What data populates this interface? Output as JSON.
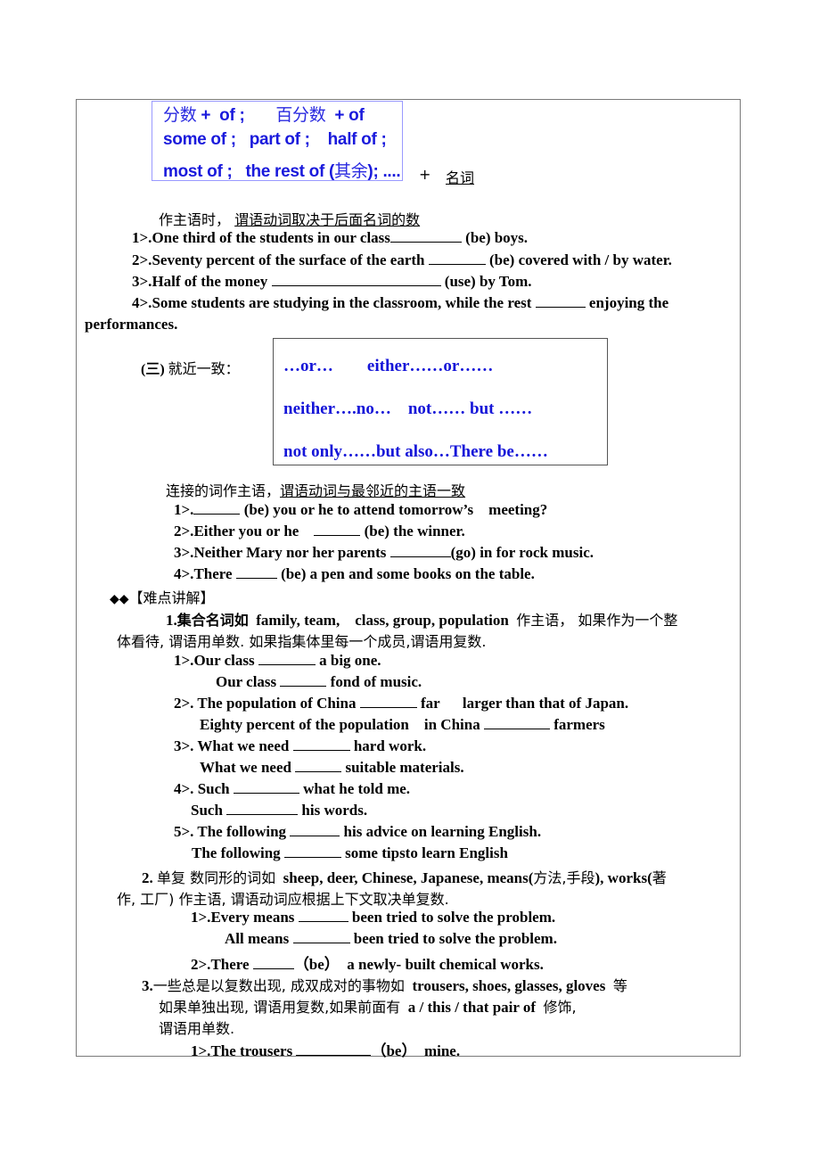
{
  "section_fraction": {
    "box_lines": [
      {
        "parts": [
          {
            "cn": "分数"
          },
          {
            "en": " +  of ;       "
          },
          {
            "cn": "百分数"
          },
          {
            "en": "  + of"
          }
        ]
      },
      {
        "parts": [
          {
            "en": "some of ;   part of ;    half of ;"
          }
        ]
      },
      {
        "parts": [
          {
            "en": "most of ;   the rest of ("
          },
          {
            "cn": "其余"
          },
          {
            "en": "); ...."
          }
        ]
      }
    ],
    "plus": "+",
    "noun_label": "名词",
    "rule_prefix": "作主语时，",
    "rule_underlined": "谓语动词取决于后面名词的数",
    "exercises": [
      {
        "num": "1>.",
        "before": "One third of the students in our class",
        "after": " (be) boys."
      },
      {
        "num": "2>.",
        "before": "Seventy percent of the surface of the earth ",
        "after": " (be) covered with / by water."
      },
      {
        "num": "3>.",
        "before": "Half of the money ",
        "after": " (use) by Tom."
      },
      {
        "num": "4>.",
        "before": "Some students are studying in the classroom, while the rest ",
        "after": " enjoying the"
      },
      {
        "continuation": "performances."
      }
    ]
  },
  "section_proximity": {
    "heading_num": "(三)",
    "heading_cn": "就近一致：",
    "box_lines": [
      "…or…        either……or……",
      "neither….no…    not…… but ……",
      "not only……but also…There be……"
    ],
    "rule_prefix": "连接的词作主语，",
    "rule_underlined": "谓语动词与最邻近的主语一致",
    "exercises": [
      {
        "num": "1>.",
        "before": "",
        "after": " (be) you or he to attend tomorrow’s    meeting?"
      },
      {
        "num": "2>.",
        "before": "Either you or he    ",
        "after": " (be) the winner."
      },
      {
        "num": "3>.",
        "before": "Neither Mary nor her parents ",
        "after": "(go) in for rock music."
      },
      {
        "num": "4>.",
        "before": "There ",
        "after": " (be) a pen and some books on the table."
      }
    ]
  },
  "difficulty_header": {
    "bullets": "◆◆",
    "title": "【难点讲解】"
  },
  "point1": {
    "line1_num": "1.",
    "line1_cn": "集合名词如",
    "line1_en": "  family, team,    class, group, population  ",
    "line1_cn2": "作主语，  如果作为一个整",
    "line2": "体看待, 谓语用单数. 如果指集体里每一个成员,谓语用复数.",
    "exercises": [
      {
        "num": "1>.",
        "before": "Our class ",
        "after": " a big one."
      },
      {
        "num": "",
        "before": "Our class ",
        "after": " fond of music."
      },
      {
        "num": "2>. ",
        "before": "The population of China ",
        "after": " far      larger than that of Japan."
      },
      {
        "num": "",
        "before": "Eighty percent of the population    in China ",
        "after": " farmers"
      },
      {
        "num": "3>. ",
        "before": "What we need ",
        "after": " hard work."
      },
      {
        "num": "",
        "before": "What we need ",
        "after": " suitable materials."
      },
      {
        "num": "4>. ",
        "before": "Such ",
        "after": " what he told me."
      },
      {
        "num": "",
        "before": "Such ",
        "after": " his words."
      },
      {
        "num": "5>. ",
        "before": "The following ",
        "after": " his advice on learning English."
      },
      {
        "num": "",
        "before": "The following ",
        "after": " some tipsto learn English"
      }
    ]
  },
  "point2": {
    "line1_num": "2. ",
    "line1_cn": "单复 数同形的词如",
    "line1_en": "  sheep, deer, Chinese, Japanese, means(",
    "line1_cn2": "方法,手段",
    "line1_en2": "), works(",
    "line1_cn3": "著",
    "line2": "作, 工厂) 作主语, 谓语动词应根据上下文取决单复数.",
    "exercises": [
      {
        "num": "1>.",
        "before": "Every means ",
        "after": " been tried to solve the problem."
      },
      {
        "num": "",
        "before": "All means ",
        "after": " been tried to solve the problem."
      },
      {
        "num": "2>.",
        "before": "There ",
        "after": "（be）  a newly- built chemical works."
      }
    ]
  },
  "point3": {
    "line1_num": "3.",
    "line1_cn": "一些总是以复数出现, 成双成对的事物如",
    "line1_en": "  trousers, shoes, glasses, gloves  ",
    "line1_cn2": "等",
    "line2_cn": "如果单独出现, 谓语用复数,如果前面有",
    "line2_en": "  a / this / that pair of  ",
    "line2_cn2": "修饰,",
    "line3": "谓语用单数.",
    "exercises": [
      {
        "num": "1>.",
        "before": "The trousers ",
        "after": "（be）  mine."
      }
    ]
  }
}
